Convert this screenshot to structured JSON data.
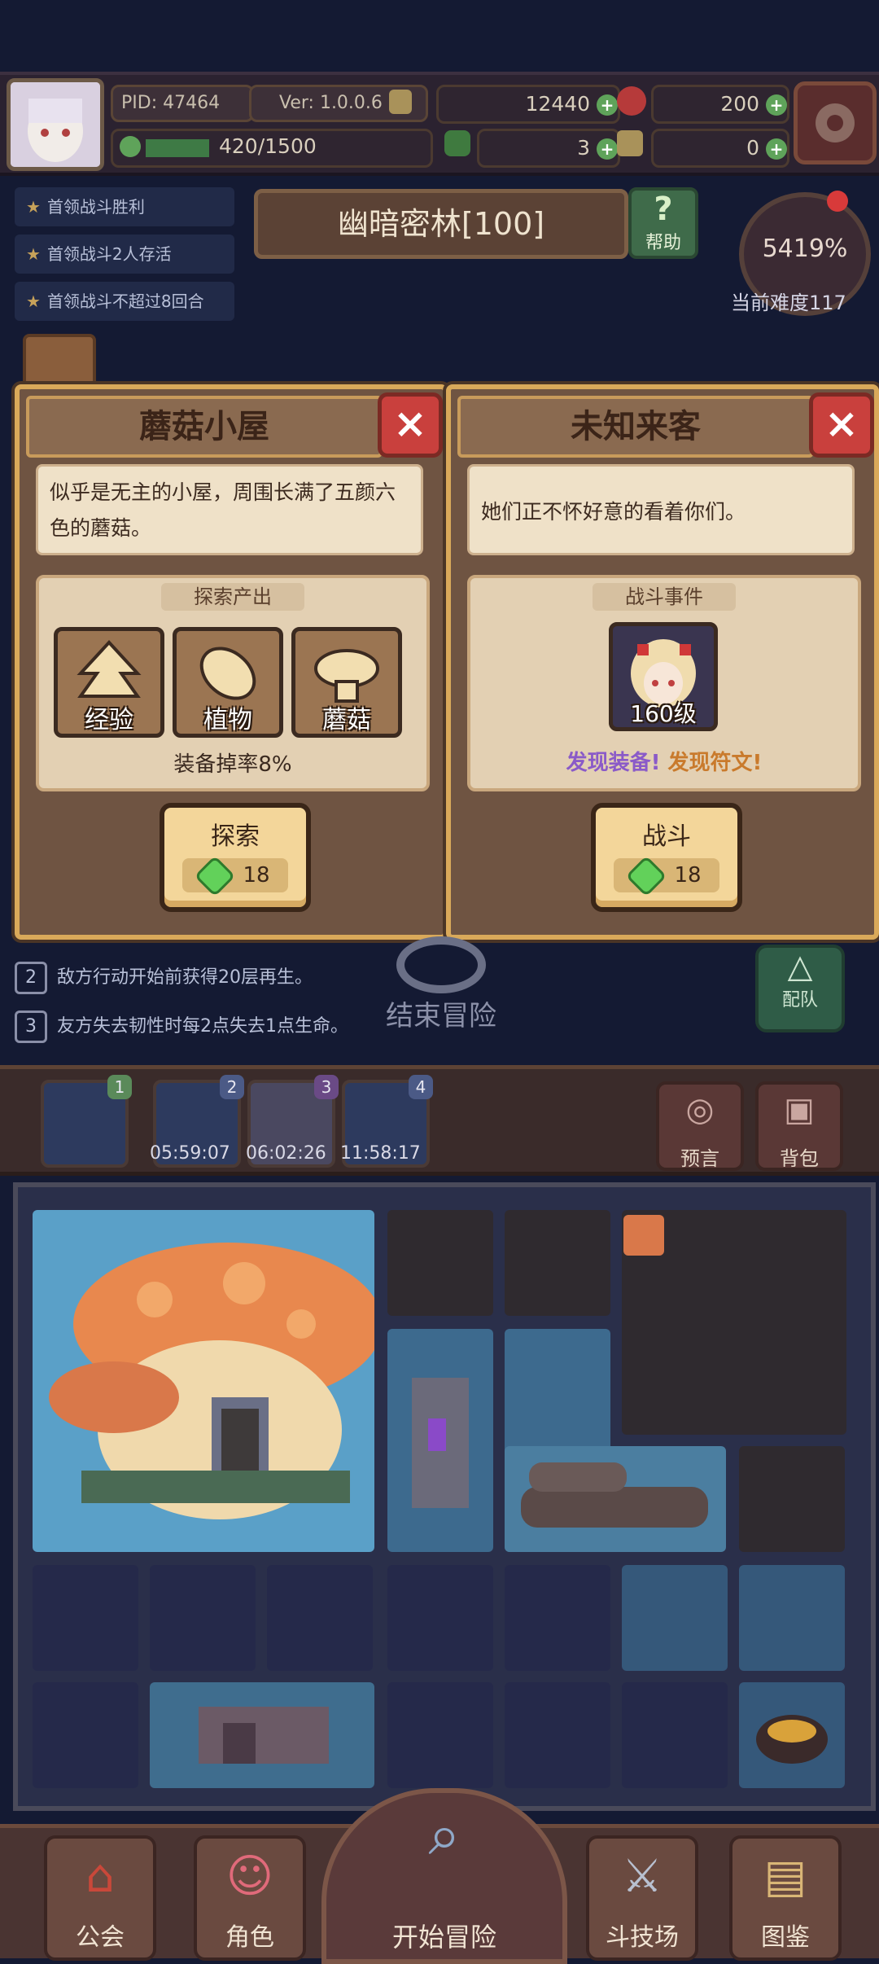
{
  "player": {
    "pid": "PID: 47464",
    "version": "Ver: 1.0.0.6",
    "energy": "420/1500",
    "gold": "12440",
    "gems": "200",
    "clover": "3",
    "keys": "0"
  },
  "quests": [
    "首领战斗胜利",
    "首领战斗2人存活",
    "首领战斗不超过8回合"
  ],
  "location": {
    "name": "幽暗密林[100]",
    "help_label": "帮助"
  },
  "difficulty": {
    "percent": "5419%",
    "label": "当前难度117"
  },
  "cards": [
    {
      "title": "蘑菇小屋",
      "description": "似乎是无主的小屋，周围长满了五颜六色的蘑菇。",
      "section_title": "探索产出",
      "items": [
        {
          "label": "经验",
          "icon": "exp-arrow-icon"
        },
        {
          "label": "植物",
          "icon": "leaf-icon"
        },
        {
          "label": "蘑菇",
          "icon": "mushroom-icon"
        }
      ],
      "drop_rate": "装备掉率8%",
      "action_label": "探索",
      "cost": "18"
    },
    {
      "title": "未知来客",
      "description": "她们正不怀好意的看着你们。",
      "section_title": "战斗事件",
      "enemy_level": "160级",
      "reward_equipment": "发现装备!",
      "reward_rune": "发现符文!",
      "action_label": "战斗",
      "cost": "18"
    }
  ],
  "rules": [
    {
      "num": "2",
      "text": "敌方行动开始前获得20层再生。"
    },
    {
      "num": "3",
      "text": "友方失去韧性时每2点失去1点生命。"
    }
  ],
  "end_adventure": "结束冒险",
  "team_label": "配队",
  "slots": [
    {
      "num": "1",
      "timer": ""
    },
    {
      "num": "2",
      "timer": "05:59:07"
    },
    {
      "num": "3",
      "timer": "06:02:26"
    },
    {
      "num": "4",
      "timer": "11:58:17"
    }
  ],
  "side_buttons": {
    "prophecy": "预言",
    "backpack": "背包"
  },
  "nav": {
    "guild": "公会",
    "character": "角色",
    "start": "开始冒险",
    "arena": "斗技场",
    "codex": "图鉴"
  },
  "colors": {
    "accent_gold": "#d9a95a",
    "gem_green": "#62d15a",
    "close_red": "#c9403d",
    "equip_purple": "#8a5ac8",
    "rune_orange": "#c97a2c"
  }
}
